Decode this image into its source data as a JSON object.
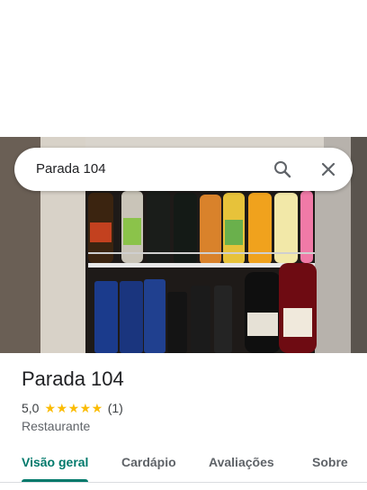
{
  "search": {
    "query": "Parada 104",
    "search_icon": "search-icon",
    "close_icon": "close-icon"
  },
  "place": {
    "name": "Parada 104",
    "rating": "5,0",
    "stars": "★★★★★",
    "review_count": "(1)",
    "category": "Restaurante"
  },
  "tabs": [
    {
      "label": "Visão geral",
      "active": true
    },
    {
      "label": "Cardápio",
      "active": false
    },
    {
      "label": "Avaliações",
      "active": false
    },
    {
      "label": "Sobre",
      "active": false
    }
  ],
  "photo": {
    "description_icon": "place-photo"
  },
  "colors": {
    "accent": "#00796b",
    "star": "#fbbc04",
    "text": "#202124",
    "secondary": "#5f6368"
  }
}
